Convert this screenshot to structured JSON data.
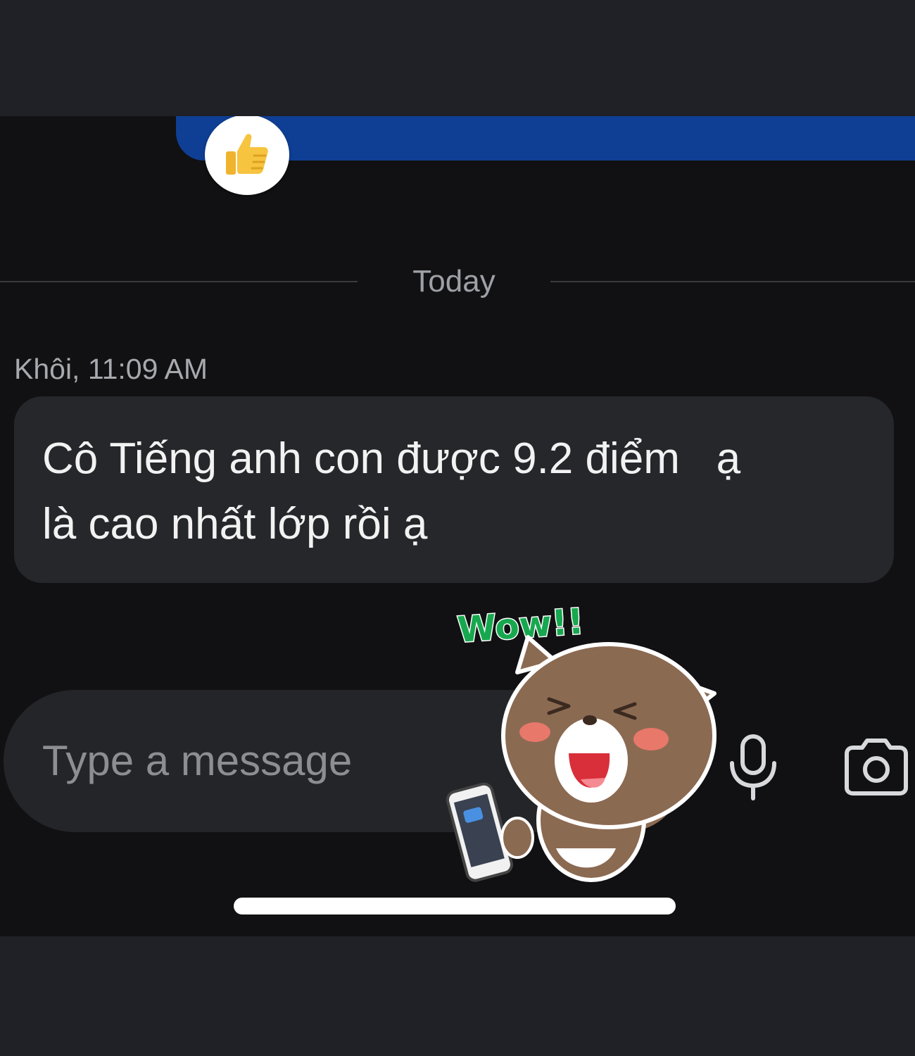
{
  "reaction": {
    "icon": "thumbs-up-icon",
    "color": "#f7c440"
  },
  "sent_bubble": {
    "color": "#0f3f94"
  },
  "date_divider": {
    "label": "Today"
  },
  "message": {
    "sender_meta": "Khôi, 11:09 AM",
    "text": "Cô Tiếng anh con được 9.2 điểm   ạ\nlà cao nhất lớp rồi ạ"
  },
  "sticker": {
    "caption": "Wow!!",
    "caption_color": "#17a84f",
    "name": "cat-phone-sticker"
  },
  "composer": {
    "placeholder": "Type a message",
    "mic_icon": "microphone-icon",
    "camera_icon": "camera-icon"
  },
  "colors": {
    "background": "#111113",
    "bubble": "#26272b",
    "text": "#f2f2f2"
  }
}
